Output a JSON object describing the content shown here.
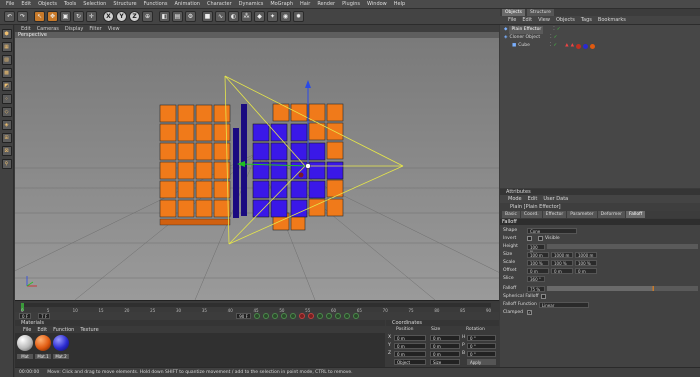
{
  "menubar": [
    "File",
    "Edit",
    "Objects",
    "Tools",
    "Selection",
    "Structure",
    "Functions",
    "Animation",
    "Character",
    "Dynamics",
    "MoGraph",
    "Hair",
    "Render",
    "Plugins",
    "Window",
    "Help"
  ],
  "viewport": {
    "menu": [
      "Edit",
      "Cameras",
      "Display",
      "Filter",
      "View"
    ],
    "label": "Perspective"
  },
  "timeline": {
    "start_field": "0 F",
    "mid_field": "7 F",
    "end_field": "90 F",
    "ticks": [
      "0",
      "5",
      "10",
      "15",
      "20",
      "25",
      "30",
      "35",
      "40",
      "45",
      "50",
      "55",
      "60",
      "65",
      "70",
      "75",
      "80",
      "85",
      "90"
    ]
  },
  "materials": {
    "header": "Materials",
    "menu": [
      "File",
      "Edit",
      "Function",
      "Texture"
    ],
    "items": [
      {
        "label": "Mat",
        "color": "#e8e8e8"
      },
      {
        "label": "Mat.1",
        "color": "#e05a10"
      },
      {
        "label": "Mat.2",
        "color": "#2a2ad0"
      }
    ]
  },
  "coordinates": {
    "header": "Coordinates",
    "columns": [
      "Position",
      "Size",
      "Rotation"
    ],
    "rows": [
      {
        "axis": "X",
        "pos": "0 m",
        "size": "0 m",
        "rot": "H",
        "rot_val": "0 °"
      },
      {
        "axis": "Y",
        "pos": "0 m",
        "size": "0 m",
        "rot": "P",
        "rot_val": "0 °"
      },
      {
        "axis": "Z",
        "pos": "0 m",
        "size": "0 m",
        "rot": "B",
        "rot_val": "0 °"
      }
    ],
    "mode": "Object",
    "size_mode": "Size",
    "apply": "Apply"
  },
  "status": {
    "time": "00:00:00",
    "message": "Move: Click and drag to move elements. Hold down SHIFT to quantize movement / add to the selection in point mode, CTRL to remove."
  },
  "objects_panel": {
    "tabs": [
      "Objects",
      "Structure"
    ],
    "menu": [
      "File",
      "Edit",
      "View",
      "Objects",
      "Tags",
      "Bookmarks"
    ],
    "rows": [
      {
        "name": "Plain Effector",
        "indent": 0
      },
      {
        "name": "Cloner Object",
        "indent": 0
      },
      {
        "name": "Cube",
        "indent": 1
      }
    ]
  },
  "attributes": {
    "header": "Attributes",
    "menu": [
      "Mode",
      "Edit",
      "User Data"
    ],
    "title": "Plain [Plain Effector]",
    "tabs": [
      "Basic",
      "Coord.",
      "Effector",
      "Parameter",
      "Deformer",
      "Falloff"
    ],
    "active_tab": "Falloff",
    "section": "Falloff",
    "fields": {
      "shape_label": "Shape",
      "shape_val": "Cone",
      "invert_label": "Invert",
      "visible_label": "Visible",
      "height_label": "Height",
      "height_val": "100 %",
      "size_label": "Size",
      "size_x": "100 m",
      "size_y": "1000 m",
      "size_z": "1000 m",
      "scale_label": "Scale",
      "scale_x": "100 %",
      "scale_y": "100 %",
      "scale_z": "100 %",
      "offset_label": "Offset",
      "offset_x": "0 m",
      "offset_y": "0 m",
      "offset_z": "0 m",
      "slice_label": "Slice",
      "slice_val": "360 °",
      "falloff_label": "Falloff",
      "falloff_val": "75 %",
      "spherical_label": "Spherical Falloff",
      "function_label": "Falloff Function",
      "function_val": "Linear",
      "clamped_label": "Clamped"
    }
  }
}
